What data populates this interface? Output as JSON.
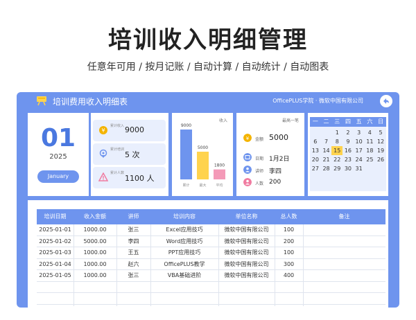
{
  "hero": {
    "title": "培训收入明细管理",
    "subtitle": "任意年可用 / 按月记账 / 自动计算 / 自动统计 / 自动图表"
  },
  "topbar": {
    "title": "培训费用收入明细表",
    "org": "OfficePLUS学院 · 微软中国有限公司"
  },
  "date": {
    "day": "01",
    "year": "2025",
    "month": "January"
  },
  "stats": [
    {
      "label": "累计收入",
      "value": "9000",
      "icon": "money-icon",
      "color": "#f4b400"
    },
    {
      "label": "累计培训",
      "value": "5 次",
      "icon": "location-icon",
      "color": "#6e94ee"
    },
    {
      "label": "累计人数",
      "value": "1100 人",
      "icon": "warning-icon",
      "color": "#f07ba0"
    }
  ],
  "chart_data": {
    "type": "bar",
    "title": "收入",
    "categories": [
      "累计",
      "最大",
      "平均"
    ],
    "values": [
      9000,
      5000,
      1800
    ],
    "colors": [
      "#6e94ee",
      "#ffd34e",
      "#f49ab8"
    ],
    "ylim": [
      0,
      9000
    ]
  },
  "detail": {
    "header": "最高一笔",
    "amount_label": "金额",
    "amount": "5000",
    "rows": [
      {
        "label": "日期",
        "value": "1月2日",
        "color": "#6e94ee"
      },
      {
        "label": "讲师",
        "value": "李四",
        "color": "#6e94ee"
      },
      {
        "label": "人数",
        "value": "200",
        "color": "#f07ba0"
      }
    ],
    "amount_color": "#f4b400"
  },
  "calendar": {
    "weekdays": [
      "一",
      "二",
      "三",
      "四",
      "五",
      "六",
      "日"
    ],
    "today": "15",
    "rows": [
      [
        "",
        "",
        "1",
        "2",
        "3",
        "4",
        "5"
      ],
      [
        "6",
        "7",
        "8",
        "9",
        "10",
        "11",
        "12"
      ],
      [
        "13",
        "14",
        "15",
        "16",
        "17",
        "18",
        "19"
      ],
      [
        "20",
        "21",
        "22",
        "23",
        "24",
        "25",
        "26"
      ],
      [
        "27",
        "28",
        "29",
        "30",
        "31",
        "",
        ""
      ]
    ]
  },
  "table": {
    "headers": [
      "培训日期",
      "收入金额",
      "讲师",
      "培训内容",
      "单位名称",
      "总人数",
      "备注"
    ],
    "rows": [
      [
        "2025-01-01",
        "1000.00",
        "张三",
        "Excel应用技巧",
        "微软中国有限公司",
        "100",
        ""
      ],
      [
        "2025-01-02",
        "5000.00",
        "李四",
        "Word应用技巧",
        "微软中国有限公司",
        "200",
        ""
      ],
      [
        "2025-01-03",
        "1000.00",
        "王五",
        "PPT应用技巧",
        "微软中国有限公司",
        "100",
        ""
      ],
      [
        "2025-01-04",
        "1000.00",
        "赵六",
        "OfficePLUS教学",
        "微软中国有限公司",
        "300",
        ""
      ],
      [
        "2025-01-05",
        "1000.00",
        "张三",
        "VBA基础进阶",
        "微软中国有限公司",
        "400",
        ""
      ],
      [
        "",
        "",
        "",
        "",
        "",
        "",
        ""
      ],
      [
        "",
        "",
        "",
        "",
        "",
        "",
        ""
      ]
    ]
  }
}
